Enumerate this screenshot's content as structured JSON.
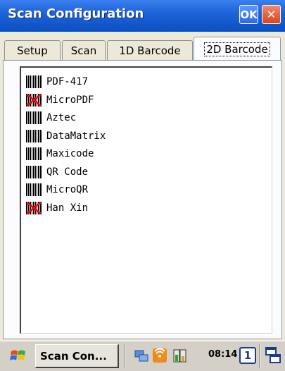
{
  "window": {
    "title": "Scan Configuration",
    "ok_label": "OK",
    "close_label": "✕"
  },
  "tabs": [
    {
      "label": "Setup",
      "active": false
    },
    {
      "label": "Scan",
      "active": false
    },
    {
      "label": "1D Barcode",
      "active": false
    },
    {
      "label": "2D Barcode",
      "active": true
    }
  ],
  "symbologies": [
    {
      "label": "PDF-417",
      "enabled": true
    },
    {
      "label": "MicroPDF",
      "enabled": false
    },
    {
      "label": "Aztec",
      "enabled": true
    },
    {
      "label": "DataMatrix",
      "enabled": true
    },
    {
      "label": "Maxicode",
      "enabled": true
    },
    {
      "label": "QR Code",
      "enabled": true
    },
    {
      "label": "MicroQR",
      "enabled": true
    },
    {
      "label": "Han Xin",
      "enabled": false
    }
  ],
  "taskbar": {
    "task_label": "Scan Con...",
    "clock": "08:14",
    "desktop_label": "1"
  },
  "colors": {
    "titlebar": "#1f63d8",
    "disabled_mark": "#e01010"
  }
}
